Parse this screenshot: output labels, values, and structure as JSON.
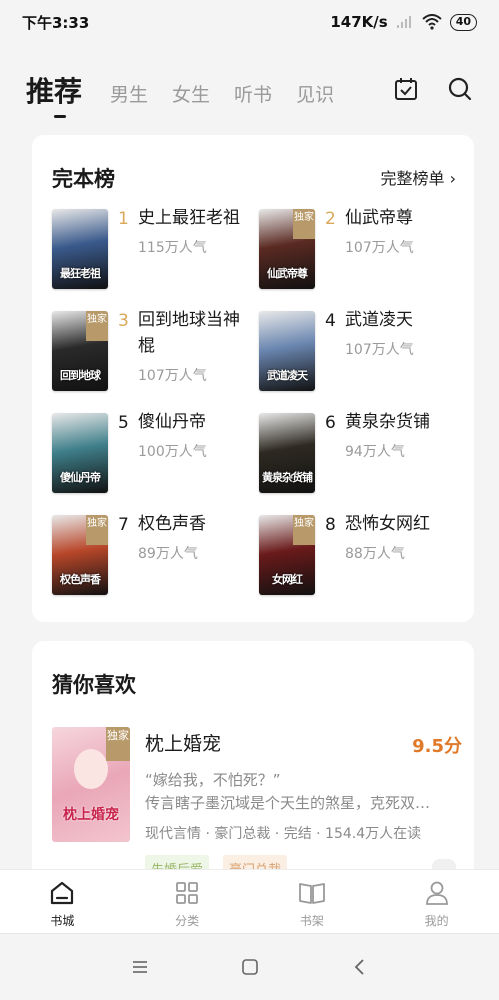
{
  "status_bar": {
    "time": "下午3:33",
    "speed": "147K/s",
    "battery": "40"
  },
  "top_nav": {
    "tabs": [
      {
        "label": "推荐",
        "active": true
      },
      {
        "label": "男生",
        "active": false
      },
      {
        "label": "女生",
        "active": false
      },
      {
        "label": "听书",
        "active": false
      },
      {
        "label": "见识",
        "active": false
      }
    ],
    "icons": [
      "calendar-check-icon",
      "search-icon"
    ]
  },
  "rank_card": {
    "title": "完本榜",
    "more_label": "完整榜单 ›",
    "items": [
      {
        "rank": "1",
        "name": "史上最狂老祖",
        "popularity": "115万人气",
        "cover_text": "最狂老祖",
        "exclusive": false,
        "cover_color": "#3a5a8c"
      },
      {
        "rank": "2",
        "name": "仙武帝尊",
        "popularity": "107万人气",
        "cover_text": "仙武帝尊",
        "exclusive": true,
        "cover_color": "#5a2a22"
      },
      {
        "rank": "3",
        "name": "回到地球当神棍",
        "popularity": "107万人气",
        "cover_text": "回到地球",
        "exclusive": true,
        "cover_color": "#2a2a2a"
      },
      {
        "rank": "4",
        "name": "武道凌天",
        "popularity": "107万人气",
        "cover_text": "武道凌天",
        "exclusive": false,
        "cover_color": "#6a86b0"
      },
      {
        "rank": "5",
        "name": "傻仙丹帝",
        "popularity": "100万人气",
        "cover_text": "傻仙丹帝",
        "exclusive": false,
        "cover_color": "#3f7f8a"
      },
      {
        "rank": "6",
        "name": "黄泉杂货铺",
        "popularity": "94万人气",
        "cover_text": "黄泉杂货铺",
        "exclusive": false,
        "cover_color": "#2e2a22"
      },
      {
        "rank": "7",
        "name": "权色声香",
        "popularity": "89万人气",
        "cover_text": "权色声香",
        "exclusive": true,
        "cover_color": "#b8472a"
      },
      {
        "rank": "8",
        "name": "恐怖女网红",
        "popularity": "88万人气",
        "cover_text": "女网红",
        "exclusive": true,
        "cover_color": "#6a1a1a"
      }
    ],
    "rank_label_colors": {
      "top3": "#d9a85a",
      "normal": "#1a1a1a"
    }
  },
  "guess_card": {
    "title": "猜你喜欢",
    "book": {
      "title": "枕上婚宠",
      "score": "9.5分",
      "cover_text": "枕上婚宠",
      "badge": "独家",
      "desc_line1": "“嫁给我，不怕死？”",
      "desc_line2": "传言瞎子墨沉域是个天生的煞星，克死双…",
      "meta": "现代言情 · 豪门总裁 · 完结 · 154.4万人在读"
    },
    "tags": [
      "先婚后爱",
      "豪门总裁"
    ]
  },
  "exclusive_label": "独家",
  "bottom_nav": {
    "items": [
      {
        "label": "书城",
        "icon": "home-icon",
        "active": true
      },
      {
        "label": "分类",
        "icon": "grid-icon",
        "active": false
      },
      {
        "label": "书架",
        "icon": "book-icon",
        "active": false
      },
      {
        "label": "我的",
        "icon": "user-icon",
        "active": false
      }
    ]
  },
  "system_nav": {
    "icons": [
      "menu-icon",
      "home-square-icon",
      "back-icon"
    ]
  }
}
